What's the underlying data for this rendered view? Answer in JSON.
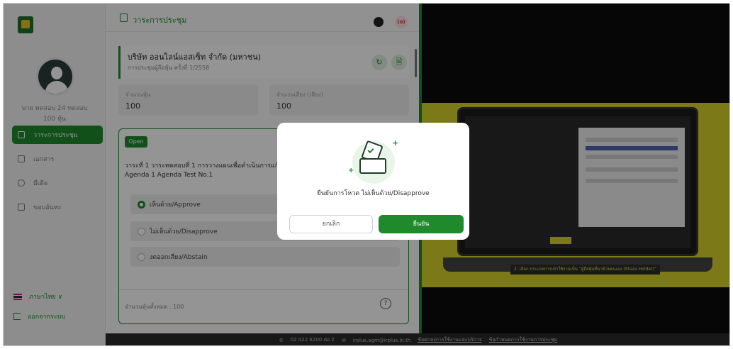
{
  "user": {
    "name": "นาย ทดสอบ 24 ทดสอบ",
    "shares": "100 หุ้น"
  },
  "sidebar": {
    "items": [
      {
        "label": "วาระการประชุม",
        "active": true
      },
      {
        "label": "เอกสาร",
        "active": false
      },
      {
        "label": "มีเดีย",
        "active": false
      },
      {
        "label": "ขอบอันทะ",
        "active": false
      }
    ],
    "language": "ภาษาไทย ∨",
    "logout": "ออกจากระบบ"
  },
  "header": {
    "title": "วาระการประชุม",
    "record_label": "(o)"
  },
  "company": {
    "name": "บริษัท ออนไลน์แอสเซ็ท จำกัด (มหาชน)",
    "meeting": "การประชุมผู้ถือหุ้น ครั้งที่ 1/2558",
    "refresh_icon": "↻",
    "doc_icon": "🗎"
  },
  "stats": [
    {
      "label": "จำนวนหุ้น",
      "value": "100"
    },
    {
      "label": "จำนวนเสียง (เสียง)",
      "value": "100"
    }
  ],
  "agenda": {
    "status": "Open",
    "title_th": "วาระที่ 1 วาระทดสอบที่ 1 การวางแผนเพื่อดำเนินการแก้",
    "title_en": "Agenda 1 Agenda Test No.1",
    "options": [
      {
        "label": "เห็นด้วย/Approve",
        "selected": true
      },
      {
        "label": "ไม่เห็นด้วย/Disapprove",
        "selected": false
      },
      {
        "label": "งดออกเสียง/Abstain",
        "selected": false
      }
    ],
    "total_label": "จำนวนหุ้นทั้งหมด : 100",
    "help_icon": "?"
  },
  "video": {
    "caption": "2. เลือก ประเภทการเข้าใช้งานเป็น “ผู้ถือหุ้นที่มาด้วยตนเอง (Share Holder)”"
  },
  "footer": {
    "phone": "02 022 6200 ต่อ 2",
    "email": "irplus.agm@irplus.in.th",
    "link1": "ข้อตกลงการใช้งานและบริการ",
    "link2": "ข้อกำหนดการใช้งานการประชุม"
  },
  "modal": {
    "message": "ยืนยันการโหวต ไม่เห็นด้วย/Disapprove",
    "cancel_label": "ยกเลิก",
    "confirm_label": "ยืนยัน"
  },
  "colors": {
    "accent": "#1e8a2c",
    "video_bg": "#d6d32a"
  }
}
